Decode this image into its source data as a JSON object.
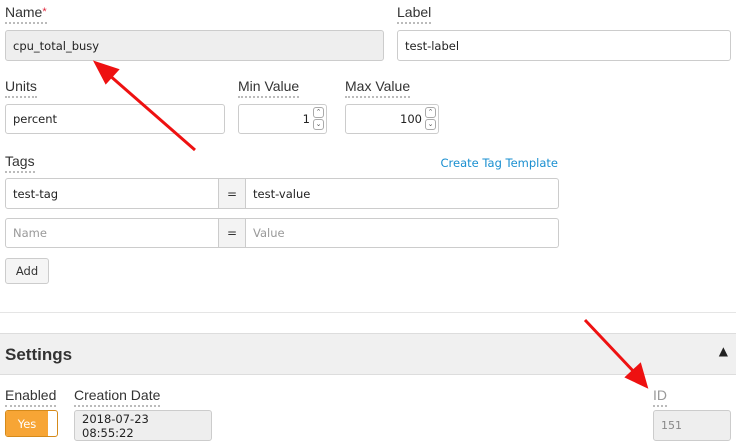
{
  "form": {
    "name": {
      "label": "Name",
      "required_mark": "*",
      "value": "cpu_total_busy"
    },
    "label": {
      "label": "Label",
      "value": "test-label"
    },
    "units": {
      "label": "Units",
      "value": "percent"
    },
    "min_value": {
      "label": "Min Value",
      "value": "1"
    },
    "max_value": {
      "label": "Max Value",
      "value": "100"
    },
    "tags": {
      "label": "Tags",
      "create_template_link": "Create Tag Template",
      "equals": "=",
      "rows": [
        {
          "name": "test-tag",
          "value": "test-value"
        }
      ],
      "new_row": {
        "name_placeholder": "Name",
        "value_placeholder": "Value"
      },
      "add_button": "Add"
    }
  },
  "settings": {
    "title": "Settings",
    "collapse_icon": "chevron-up-icon",
    "enabled": {
      "label": "Enabled",
      "value": "Yes"
    },
    "creation_date": {
      "label": "Creation Date",
      "value": "2018-07-23 08:55:22"
    },
    "id": {
      "label": "ID",
      "value": "151"
    }
  },
  "colors": {
    "accent": "#f7a535",
    "link": "#1a8fd0",
    "annotation_arrow": "#ee1111",
    "required": "#e0283c"
  }
}
